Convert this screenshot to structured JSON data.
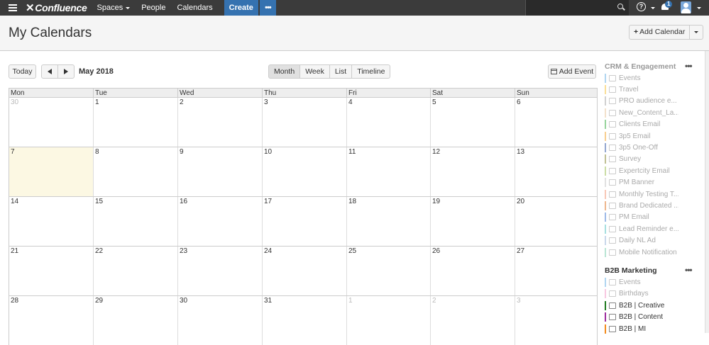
{
  "nav": {
    "logo": "Confluence",
    "spaces": "Spaces",
    "people": "People",
    "calendars": "Calendars",
    "create": "Create",
    "more": "•••",
    "help": "?",
    "notification_count": "1"
  },
  "header": {
    "title": "My Calendars",
    "add_calendar": "Add Calendar"
  },
  "toolbar": {
    "today": "Today",
    "month_label": "May 2018",
    "views": [
      "Month",
      "Week",
      "List",
      "Timeline"
    ],
    "active_view": "Month",
    "add_event": "Add Event"
  },
  "calendar": {
    "days_of_week": [
      "Mon",
      "Tue",
      "Wed",
      "Thu",
      "Fri",
      "Sat",
      "Sun"
    ],
    "weeks": [
      [
        "30",
        "1",
        "2",
        "3",
        "4",
        "5",
        "6"
      ],
      [
        "7",
        "8",
        "9",
        "10",
        "11",
        "12",
        "13"
      ],
      [
        "14",
        "15",
        "16",
        "17",
        "18",
        "19",
        "20"
      ],
      [
        "21",
        "22",
        "23",
        "24",
        "25",
        "26",
        "27"
      ],
      [
        "28",
        "29",
        "30",
        "31",
        "1",
        "2",
        "3"
      ]
    ]
  },
  "sidebar": {
    "groups": [
      {
        "title": "CRM & Engagement ...",
        "more": "•••",
        "items": [
          {
            "label": "Events",
            "color": "#6fb2e3"
          },
          {
            "label": "Travel",
            "color": "#f5c542"
          },
          {
            "label": "PRO audience e...",
            "color": "#a9a9a9"
          },
          {
            "label": "New_Content_La...",
            "color": "#e8c9a0"
          },
          {
            "label": "Clients Email",
            "color": "#3fae49"
          },
          {
            "label": "3p5 Email",
            "color": "#f2a531"
          },
          {
            "label": "3p5 One-Off",
            "color": "#3a5fa8"
          },
          {
            "label": "Survey",
            "color": "#8b8b3b"
          },
          {
            "label": "Expertcity Email",
            "color": "#a0c15a"
          },
          {
            "label": "PM Banner",
            "color": "#c9c9c9"
          },
          {
            "label": "Monthly Testing T...",
            "color": "#f29a7a"
          },
          {
            "label": "Brand Dedicated ...",
            "color": "#e07a2e"
          },
          {
            "label": "PM Email",
            "color": "#4a7fd4"
          },
          {
            "label": "Lead Reminder e...",
            "color": "#5bc4c4"
          },
          {
            "label": "Daily NL Ad",
            "color": "#9cb7d8"
          },
          {
            "label": "Mobile Notification",
            "color": "#7fcfb1"
          }
        ]
      },
      {
        "title": "B2B Marketing",
        "more": "•••",
        "items": [
          {
            "label": "Events",
            "color": "#6fb2e3"
          },
          {
            "label": "Birthdays",
            "color": "#f29ac9"
          },
          {
            "label": "B2B | Creative",
            "color": "#1e7a1e"
          },
          {
            "label": "B2B | Content",
            "color": "#9c2a9c"
          },
          {
            "label": "B2B | MI",
            "color": "#f28a1a"
          }
        ]
      }
    ]
  }
}
